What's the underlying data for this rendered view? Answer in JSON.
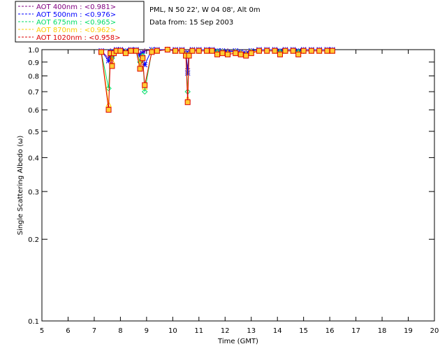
{
  "header": {
    "site_line": "PML, N 50 22', W 04 08', Alt 0m",
    "date_line": "Data from: 15 Sep 2003"
  },
  "chart_data": {
    "type": "line",
    "xlabel": "Time (GMT)",
    "ylabel": "Single Scattering Albedo (ω)",
    "xlim": [
      5,
      20
    ],
    "ylim": [
      0.1,
      1.0
    ],
    "yscale": "log",
    "x_ticks": [
      5,
      6,
      7,
      8,
      9,
      10,
      11,
      12,
      13,
      14,
      15,
      16,
      17,
      18,
      19,
      20
    ],
    "y_ticks": [
      1.0,
      0.9,
      0.8,
      0.7,
      0.6,
      0.5,
      0.4,
      0.3,
      0.2,
      0.1
    ],
    "y_tick_labels": [
      "1.0",
      "0.9",
      "0.8",
      "0.7",
      "0.6",
      "0.5",
      "0.4",
      "0.3",
      "0.2",
      "0.1"
    ],
    "grid": false,
    "legend_position": "top-left",
    "series": [
      {
        "name": "AOT  400nm : <0.981>",
        "color": "#800080",
        "marker": "plus",
        "x": [
          7.27,
          7.55,
          7.62,
          7.68,
          7.75,
          7.85,
          8.0,
          8.2,
          8.4,
          8.6,
          8.75,
          8.85,
          8.93,
          9.2,
          9.4,
          9.8,
          10.1,
          10.35,
          10.5,
          10.57,
          10.62,
          10.75,
          11.0,
          11.3,
          11.5,
          11.7,
          11.9,
          12.1,
          12.4,
          12.6,
          12.8,
          13.0,
          13.3,
          13.6,
          13.9,
          14.1,
          14.3,
          14.6,
          14.8,
          15.0,
          15.3,
          15.6,
          15.9,
          16.1
        ],
        "values": [
          0.99,
          0.93,
          0.99,
          0.97,
          0.99,
          1.0,
          1.0,
          0.99,
          1.0,
          1.0,
          0.96,
          0.98,
          0.99,
          1.0,
          1.0,
          1.0,
          1.0,
          1.0,
          0.98,
          0.85,
          0.98,
          1.0,
          1.0,
          1.0,
          1.0,
          0.99,
          0.99,
          0.99,
          0.99,
          0.98,
          0.98,
          0.99,
          1.0,
          1.0,
          1.0,
          0.99,
          1.0,
          1.0,
          0.99,
          1.0,
          1.0,
          1.0,
          1.0,
          1.0
        ]
      },
      {
        "name": "AOT  500nm : <0.976>",
        "color": "#0000ff",
        "marker": "star",
        "x": [
          7.27,
          7.55,
          7.62,
          7.68,
          7.75,
          7.85,
          8.0,
          8.2,
          8.4,
          8.6,
          8.75,
          8.85,
          8.93,
          9.2,
          9.4,
          9.8,
          10.1,
          10.35,
          10.5,
          10.57,
          10.62,
          10.75,
          11.0,
          11.3,
          11.5,
          11.7,
          11.9,
          12.1,
          12.4,
          12.6,
          12.8,
          13.0,
          13.3,
          13.6,
          13.9,
          14.1,
          14.3,
          14.6,
          14.8,
          15.0,
          15.3,
          15.6,
          15.9,
          16.1
        ],
        "values": [
          0.99,
          0.91,
          0.98,
          0.96,
          0.98,
          1.0,
          1.0,
          0.99,
          1.0,
          1.0,
          0.95,
          0.97,
          0.88,
          1.0,
          1.0,
          1.0,
          1.0,
          1.0,
          0.97,
          0.82,
          0.97,
          1.0,
          1.0,
          1.0,
          1.0,
          0.99,
          0.99,
          0.98,
          0.99,
          0.98,
          0.97,
          0.99,
          1.0,
          1.0,
          1.0,
          0.99,
          1.0,
          1.0,
          0.99,
          1.0,
          1.0,
          1.0,
          1.0,
          1.0
        ]
      },
      {
        "name": "AOT  675nm : <0.965>",
        "color": "#00dd66",
        "marker": "diamond",
        "x": [
          7.27,
          7.55,
          7.62,
          7.68,
          7.75,
          7.85,
          8.0,
          8.2,
          8.4,
          8.6,
          8.75,
          8.85,
          8.93,
          9.2,
          9.4,
          9.8,
          10.1,
          10.35,
          10.5,
          10.57,
          10.62,
          10.75,
          11.0,
          11.3,
          11.5,
          11.7,
          11.9,
          12.1,
          12.4,
          12.6,
          12.8,
          13.0,
          13.3,
          13.6,
          13.9,
          14.1,
          14.3,
          14.6,
          14.8,
          15.0,
          15.3,
          15.6,
          15.9,
          16.1
        ],
        "values": [
          0.98,
          0.72,
          0.97,
          0.93,
          0.97,
          0.99,
          0.99,
          0.98,
          0.99,
          0.99,
          0.9,
          0.95,
          0.7,
          0.99,
          0.99,
          1.0,
          0.99,
          0.99,
          0.96,
          0.7,
          0.96,
          0.99,
          0.99,
          0.99,
          0.99,
          0.98,
          0.98,
          0.97,
          0.98,
          0.97,
          0.96,
          0.98,
          0.99,
          0.99,
          0.99,
          0.98,
          0.99,
          0.99,
          0.98,
          0.99,
          0.99,
          0.99,
          0.99,
          0.99
        ]
      },
      {
        "name": "AOT  870nm : <0.962>",
        "color": "#ffcc00",
        "marker": "triangle",
        "x": [
          7.27,
          7.55,
          7.62,
          7.68,
          7.75,
          7.85,
          8.0,
          8.2,
          8.4,
          8.6,
          8.75,
          8.85,
          8.93,
          9.2,
          9.4,
          9.8,
          10.1,
          10.35,
          10.5,
          10.57,
          10.62,
          10.75,
          11.0,
          11.3,
          11.5,
          11.7,
          11.9,
          12.1,
          12.4,
          12.6,
          12.8,
          13.0,
          13.3,
          13.6,
          13.9,
          14.1,
          14.3,
          14.6,
          14.8,
          15.0,
          15.3,
          15.6,
          15.9,
          16.1
        ],
        "values": [
          0.98,
          0.63,
          0.97,
          0.91,
          0.97,
          0.99,
          0.99,
          0.98,
          0.99,
          0.99,
          0.88,
          0.94,
          0.73,
          0.99,
          0.99,
          1.0,
          0.99,
          0.99,
          0.96,
          0.66,
          0.96,
          0.99,
          0.99,
          0.99,
          0.99,
          0.97,
          0.98,
          0.97,
          0.98,
          0.97,
          0.96,
          0.98,
          0.99,
          0.99,
          0.99,
          0.97,
          0.99,
          0.99,
          0.97,
          0.99,
          0.99,
          0.99,
          0.99,
          0.99
        ]
      },
      {
        "name": "AOT 1020nm : <0.958>",
        "color": "#dd0000",
        "marker": "square",
        "x": [
          7.27,
          7.55,
          7.62,
          7.68,
          7.75,
          7.85,
          8.0,
          8.2,
          8.4,
          8.6,
          8.75,
          8.85,
          8.93,
          9.2,
          9.4,
          9.8,
          10.1,
          10.35,
          10.5,
          10.57,
          10.62,
          10.75,
          11.0,
          11.3,
          11.5,
          11.7,
          11.9,
          12.1,
          12.4,
          12.6,
          12.8,
          13.0,
          13.3,
          13.6,
          13.9,
          14.1,
          14.3,
          14.6,
          14.8,
          15.0,
          15.3,
          15.6,
          15.9,
          16.1
        ],
        "values": [
          0.98,
          0.6,
          0.97,
          0.87,
          0.97,
          0.99,
          0.99,
          0.97,
          0.99,
          0.99,
          0.85,
          0.93,
          0.74,
          0.98,
          0.99,
          1.0,
          0.99,
          0.99,
          0.95,
          0.64,
          0.95,
          0.99,
          0.99,
          0.99,
          0.99,
          0.96,
          0.97,
          0.96,
          0.97,
          0.96,
          0.95,
          0.97,
          0.99,
          0.99,
          0.99,
          0.96,
          0.99,
          0.99,
          0.96,
          0.99,
          0.99,
          0.99,
          0.99,
          0.99
        ]
      }
    ]
  }
}
